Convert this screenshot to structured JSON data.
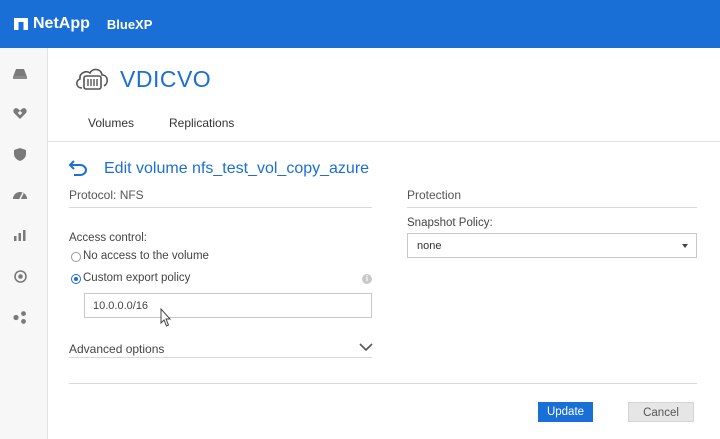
{
  "topbar": {
    "brand": "NetApp",
    "product": "BlueXP"
  },
  "sidebar": {
    "items": [
      {
        "icon": "storage-icon"
      },
      {
        "icon": "health-icon"
      },
      {
        "icon": "protection-icon"
      },
      {
        "icon": "performance-icon"
      },
      {
        "icon": "analytics-icon"
      },
      {
        "icon": "globe-icon"
      },
      {
        "icon": "share-icon"
      }
    ]
  },
  "workspace": {
    "name": "VDICVO"
  },
  "tabs": [
    {
      "label": "Volumes"
    },
    {
      "label": "Replications"
    }
  ],
  "edit": {
    "title": "Edit volume nfs_test_vol_copy_azure"
  },
  "left": {
    "protocol_label": "Protocol: NFS",
    "access_control_label": "Access control:",
    "option_no_access": "No access to the volume",
    "option_custom_policy": "Custom export policy",
    "selected_option": "custom",
    "export_policy_value": "10.0.0.0/16",
    "info_glyph": "i",
    "advanced_label": "Advanced options"
  },
  "right": {
    "protection_label": "Protection",
    "snapshot_policy_label": "Snapshot Policy:",
    "snapshot_policy_value": "none"
  },
  "actions": {
    "update": "Update",
    "cancel": "Cancel"
  },
  "colors": {
    "brand_blue": "#1a6fd6"
  }
}
